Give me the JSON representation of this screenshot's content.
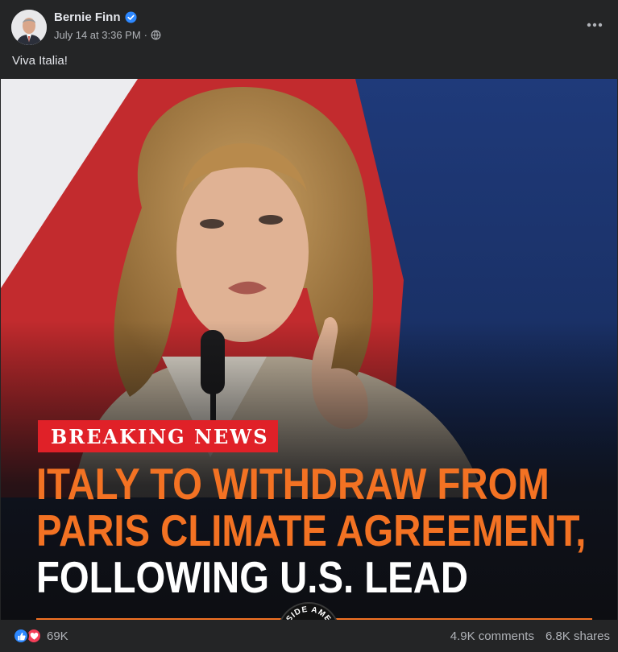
{
  "post": {
    "author": "Bernie Finn",
    "timestamp": "July 14 at 3:36 PM",
    "separator": "·",
    "caption": "Viva Italia!"
  },
  "image": {
    "badge": "BREAKING NEWS",
    "headline_line1": "ITALY TO WITHDRAW FROM",
    "headline_line2": "PARIS CLIMATE AGREEMENT,",
    "headline_line3": "FOLLOWING U.S. LEAD",
    "logo_text": "ESIDE AME"
  },
  "footer": {
    "reaction_count": "69K",
    "comments": "4.9K comments",
    "shares": "6.8K shares"
  },
  "colors": {
    "background": "#242526",
    "badge_red": "#e02128",
    "headline_orange": "#f37223",
    "like_blue": "#2d88ff",
    "love_red": "#f33e58",
    "verified_blue": "#2d88ff"
  },
  "icons": [
    "verified-badge-icon",
    "globe-icon",
    "more-options-icon",
    "like-reaction-icon",
    "love-reaction-icon"
  ]
}
